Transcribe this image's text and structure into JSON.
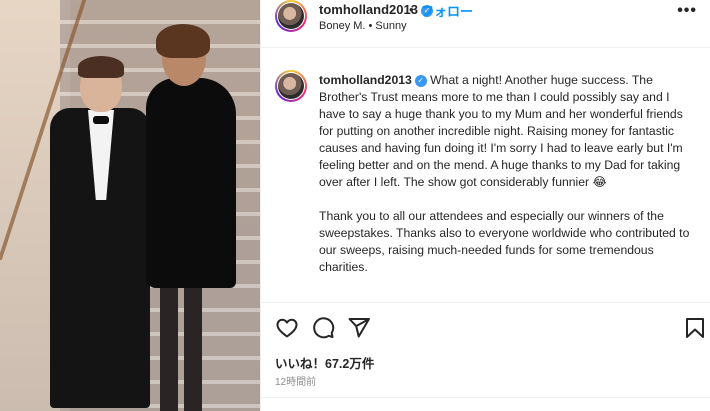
{
  "post": {
    "username": "tomholland2013",
    "verified_glyph": "✓",
    "separator": "•",
    "follow_label": "フォロー",
    "music": "Boney M. • Sunny",
    "more_label": "•••"
  },
  "caption": {
    "username": "tomholland2013",
    "paragraph1": "What a night! Another huge success. The Brother's Trust means more to me than I could possibly say and I have to say a huge thank you to my Mum and her wonderful friends for putting on another incredible night. Raising money for fantastic causes and having fun doing it! I'm sorry I had to leave early but I'm feeling better and on the mend. A huge thanks to my Dad for taking over after I left. The show got considerably funnier 😂",
    "paragraph2": "Thank you to all our attendees and especially our winners of the sweepstakes. Thanks also to everyone worldwide who contributed to our sweeps, raising much-needed funds for some tremendous charities."
  },
  "actions": {
    "likes": "いいね！67.2万件",
    "timestamp": "12時間前"
  },
  "icons": {
    "heart": "heart-icon",
    "comment": "comment-icon",
    "share": "share-icon",
    "save": "bookmark-icon"
  },
  "colors": {
    "link_blue": "#0095f6",
    "verified_blue": "#3897f0",
    "text": "#262626",
    "muted": "#8e8e8e"
  }
}
